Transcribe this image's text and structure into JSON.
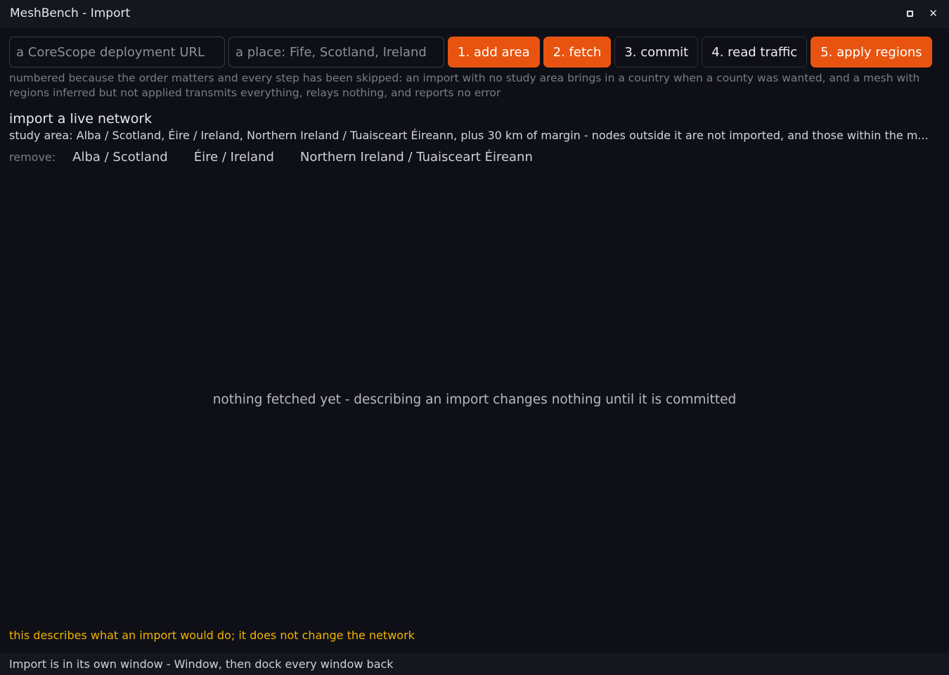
{
  "window": {
    "title": "MeshBench - Import",
    "icons": {
      "restore": "restore-icon",
      "close": "close-icon"
    }
  },
  "toolbar": {
    "url_placeholder": "a CoreScope deployment URL",
    "place_placeholder": "a place: Fife, Scotland, Ireland",
    "buttons": [
      {
        "label": "1. add area",
        "style": "primary"
      },
      {
        "label": "2. fetch",
        "style": "primary"
      },
      {
        "label": "3. commit",
        "style": "secondary"
      },
      {
        "label": "4. read traffic",
        "style": "secondary"
      },
      {
        "label": "5. apply regions",
        "style": "primary"
      }
    ]
  },
  "hint": "numbered because the order matters and every step has been skipped: an import with no study area brings in a country when a county was wanted, and a mesh with regions inferred but not applied transmits everything, relays nothing, and reports no error",
  "section": {
    "title": "import a live network",
    "study_area": "study area: Alba / Scotland, Éire / Ireland, Northern Ireland / Tuaisceart Éireann, plus 30 km of margin - nodes outside it are not imported, and those within the m...",
    "remove_label": "remove:",
    "areas": [
      "Alba / Scotland",
      "Éire / Ireland",
      "Northern Ireland / Tuaisceart Éireann"
    ]
  },
  "empty_message": "nothing fetched yet - describing an import changes nothing until it is committed",
  "warning": "this describes what an import would do; it does not change the network",
  "status": "Import is in its own window - Window, then dock every window back",
  "colors": {
    "accent": "#e8540f",
    "warning": "#f0b400",
    "background": "#0f0f17"
  }
}
